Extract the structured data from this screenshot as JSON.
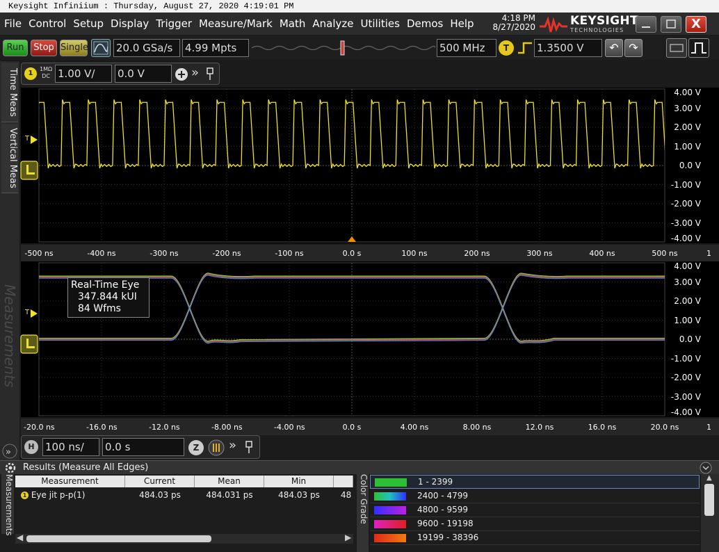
{
  "title_bar": "Keysight Infiniium : Thursday, August 27, 2020 4:19:01 PM",
  "menu": [
    "File",
    "Control",
    "Setup",
    "Display",
    "Trigger",
    "Measure/Mark",
    "Math",
    "Analyze",
    "Utilities",
    "Demos",
    "Help"
  ],
  "clock": {
    "time": "4:18 PM",
    "date": "8/27/2020"
  },
  "logo": {
    "name": "KEYSIGHT",
    "sub": "TECHNOLOGIES"
  },
  "window_close": "X",
  "toolbar": {
    "run": "Run",
    "stop": "Stop",
    "single": "Single",
    "sample_rate": "20.0 GSa/s",
    "memory_depth": "4.99 Mpts",
    "bandwidth": "500 MHz",
    "trigger_badge": "T",
    "trigger_level": "1.3500 V"
  },
  "side_tabs": [
    "Time Meas",
    "Vertical Meas",
    "Measurements"
  ],
  "channel": {
    "number": "1",
    "impedance": "1MΩ",
    "coupling": "DC",
    "scale": "1.00 V/",
    "offset": "0.0 V"
  },
  "pane1": {
    "y_labels": [
      "4.00 V",
      "3.00 V",
      "2.00 V",
      "1.00 V",
      "0.0 V",
      "-1.00 V",
      "-2.00 V",
      "-3.00 V",
      "-4.00 V"
    ],
    "x_labels": [
      "-500 ns",
      "-400 ns",
      "-300 ns",
      "-200 ns",
      "-100 ns",
      "0.0 s",
      "100 ns",
      "200 ns",
      "300 ns",
      "400 ns",
      "500 ns"
    ],
    "x_extra": "1"
  },
  "pane2": {
    "y_labels": [
      "4.00 V",
      "3.00 V",
      "2.00 V",
      "1.00 V",
      "0.0 V",
      "-1.00 V",
      "-2.00 V",
      "-3.00 V",
      "-4.00 V"
    ],
    "x_labels": [
      "-20.0 ns",
      "-16.0 ns",
      "-12.0 ns",
      "-8.00 ns",
      "-4.00 ns",
      "0.0 s",
      "4.00 ns",
      "8.00 ns",
      "12.0 ns",
      "16.0 ns",
      "20.0 ns"
    ],
    "x_extra": "1"
  },
  "eye_info": {
    "title": "Real-Time Eye",
    "ui": "347.844 kUI",
    "wfms": "84 Wfms"
  },
  "marker_t": "T",
  "horizontal": {
    "badge": "H",
    "scale": "100 ns/",
    "position": "0.0 s",
    "zoom_badge": "Z"
  },
  "results": {
    "title": "Results (Measure All Edges)",
    "side_label": "Measurements",
    "columns": [
      "Measurement",
      "Current",
      "Mean",
      "Min",
      "Ma"
    ],
    "row": {
      "badge": "1",
      "name": "Eye jit p-p(1)",
      "current": "484.03 ps",
      "mean": "484.031 ps",
      "min": "484.03 ps",
      "max": "48"
    }
  },
  "color_grade": {
    "label": "Color Grade",
    "ranges": [
      "1 - 2399",
      "2400 - 4799",
      "4800 - 9599",
      "9600 - 19198",
      "19199 - 38396"
    ]
  },
  "colors": {
    "trace": "#f0e030",
    "grid": "#3a3a3a",
    "accent_selected": "#6a8ab8",
    "trigger_marker": "#f08c00"
  }
}
